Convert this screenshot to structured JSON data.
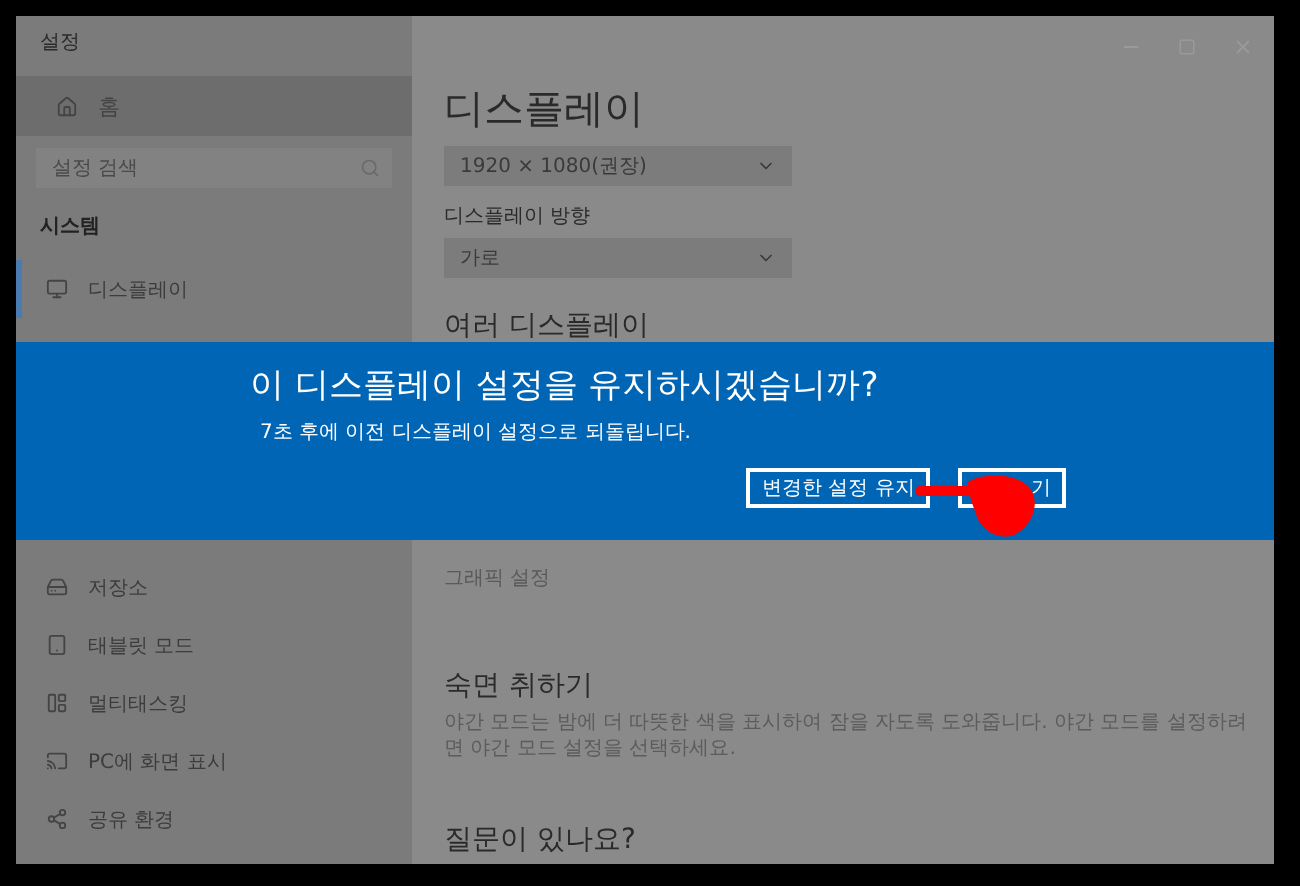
{
  "window": {
    "title": "설정"
  },
  "sidebar": {
    "home": "홈",
    "search": {
      "placeholder": "설정 검색"
    },
    "section": "시스템",
    "items": [
      {
        "label": "디스플레이",
        "selected": true
      },
      {
        "label": "저장소",
        "selected": false
      },
      {
        "label": "태블릿 모드",
        "selected": false
      },
      {
        "label": "멀티태스킹",
        "selected": false
      },
      {
        "label": "PC에 화면 표시",
        "selected": false
      },
      {
        "label": "공유 환경",
        "selected": false
      }
    ]
  },
  "main": {
    "title": "디스플레이",
    "resolution": "1920 × 1080(권장)",
    "orientation_label": "디스플레이 방향",
    "orientation": "가로",
    "multi_heading": "여러 디스플레이",
    "graphics_link": "그래픽 설정",
    "sleep_heading": "숙면 취하기",
    "sleep_text": "야간 모드는 밤에 더 따뜻한 색을 표시하여 잠을 자도록 도와줍니다. 야간 모드를 설정하려면 야간 모드 설정을 선택하세요.",
    "questions_heading": "질문이 있나요?"
  },
  "dialog": {
    "title": "이 디스플레이 설정을 유지하시겠습니까?",
    "message": "7초 후에 이전 디스플레이 설정으로 되돌립니다.",
    "buttons": [
      {
        "label": "변경한 설정 유지"
      },
      {
        "label": "기"
      }
    ]
  }
}
